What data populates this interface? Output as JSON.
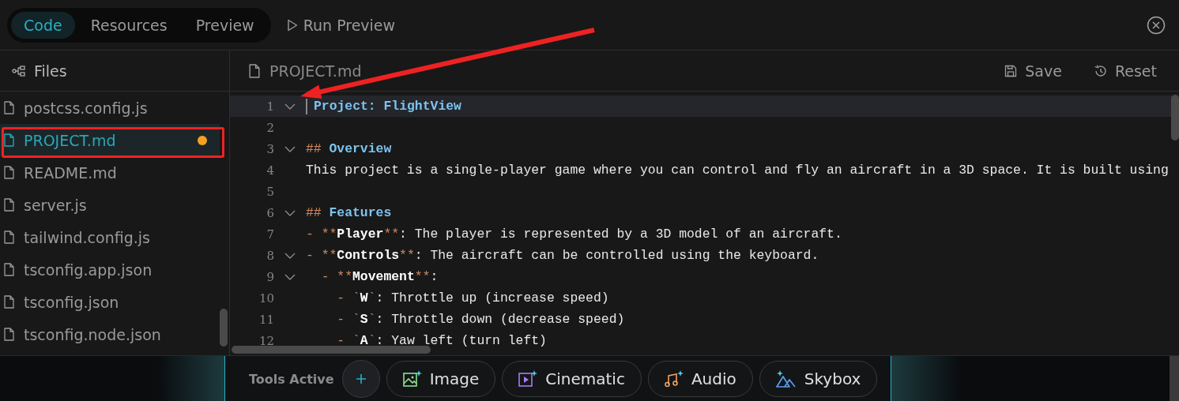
{
  "tabs": [
    {
      "label": "Code",
      "selected": true
    },
    {
      "label": "Resources",
      "selected": false
    },
    {
      "label": "Preview",
      "selected": false
    }
  ],
  "run_button": "Run Preview",
  "sidebar": {
    "title": "Files",
    "files": [
      {
        "name": "postcss.config.js",
        "selected": false,
        "modified": false
      },
      {
        "name": "PROJECT.md",
        "selected": true,
        "modified": true
      },
      {
        "name": "README.md",
        "selected": false,
        "modified": false
      },
      {
        "name": "server.js",
        "selected": false,
        "modified": false
      },
      {
        "name": "tailwind.config.js",
        "selected": false,
        "modified": false
      },
      {
        "name": "tsconfig.app.json",
        "selected": false,
        "modified": false
      },
      {
        "name": "tsconfig.json",
        "selected": false,
        "modified": false
      },
      {
        "name": "tsconfig.node.json",
        "selected": false,
        "modified": false
      }
    ]
  },
  "editor": {
    "file_tab": "PROJECT.md",
    "actions": [
      {
        "kind": "save",
        "label": "Save"
      },
      {
        "kind": "reset",
        "label": "Reset"
      }
    ],
    "lines": [
      {
        "number": "1",
        "fold": true,
        "current": true,
        "tokens": [
          {
            "kind": "heading",
            "text": "Project: FlightView"
          }
        ]
      },
      {
        "number": "2",
        "fold": false,
        "current": false
      },
      {
        "number": "3",
        "fold": true,
        "current": false,
        "tokens": [
          {
            "kind": "marker",
            "text": "##"
          },
          {
            "kind": "heading",
            "text": " Overview"
          }
        ]
      },
      {
        "number": "4",
        "fold": false,
        "current": false,
        "tokens": [
          {
            "kind": "text",
            "text": "This project is a single-player game where you can control and fly an aircraft in a 3D space. It is built using"
          }
        ]
      },
      {
        "number": "5",
        "fold": false,
        "current": false
      },
      {
        "number": "6",
        "fold": true,
        "current": false,
        "tokens": [
          {
            "kind": "marker",
            "text": "##"
          },
          {
            "kind": "heading",
            "text": " Features"
          }
        ]
      },
      {
        "number": "7",
        "fold": false,
        "current": false,
        "tokens": [
          {
            "kind": "marker",
            "text": "- **"
          },
          {
            "kind": "bold",
            "text": "Player"
          },
          {
            "kind": "marker",
            "text": "**"
          },
          {
            "kind": "text",
            "text": ": The player is represented by a 3D model of an aircraft."
          }
        ]
      },
      {
        "number": "8",
        "fold": true,
        "current": false,
        "tokens": [
          {
            "kind": "marker",
            "text": "- **"
          },
          {
            "kind": "bold",
            "text": "Controls"
          },
          {
            "kind": "marker",
            "text": "**"
          },
          {
            "kind": "text",
            "text": ": The aircraft can be controlled using the keyboard."
          }
        ]
      },
      {
        "number": "9",
        "fold": true,
        "current": false,
        "tokens": [
          {
            "kind": "marker",
            "text": "  - **"
          },
          {
            "kind": "bold",
            "text": "Movement"
          },
          {
            "kind": "marker",
            "text": "**"
          },
          {
            "kind": "text",
            "text": ":"
          }
        ]
      },
      {
        "number": "10",
        "fold": false,
        "current": false,
        "tokens": [
          {
            "kind": "marker",
            "text": "    - `"
          },
          {
            "kind": "bold",
            "text": "W"
          },
          {
            "kind": "marker",
            "text": "`"
          },
          {
            "kind": "text",
            "text": ": Throttle up (increase speed)"
          }
        ]
      },
      {
        "number": "11",
        "fold": false,
        "current": false,
        "tokens": [
          {
            "kind": "marker",
            "text": "    - `"
          },
          {
            "kind": "bold",
            "text": "S"
          },
          {
            "kind": "marker",
            "text": "`"
          },
          {
            "kind": "text",
            "text": ": Throttle down (decrease speed)"
          }
        ]
      },
      {
        "number": "12",
        "fold": false,
        "current": false,
        "tokens": [
          {
            "kind": "marker",
            "text": "    - `"
          },
          {
            "kind": "bold",
            "text": "A"
          },
          {
            "kind": "marker",
            "text": "`"
          },
          {
            "kind": "text",
            "text": ": Yaw left (turn left)"
          }
        ]
      }
    ]
  },
  "toolbar": {
    "label": "Tools Active",
    "tools": [
      {
        "kind": "image",
        "label": "Image"
      },
      {
        "kind": "cinematic",
        "label": "Cinematic"
      },
      {
        "kind": "audio",
        "label": "Audio"
      },
      {
        "kind": "skybox",
        "label": "Skybox"
      }
    ]
  }
}
